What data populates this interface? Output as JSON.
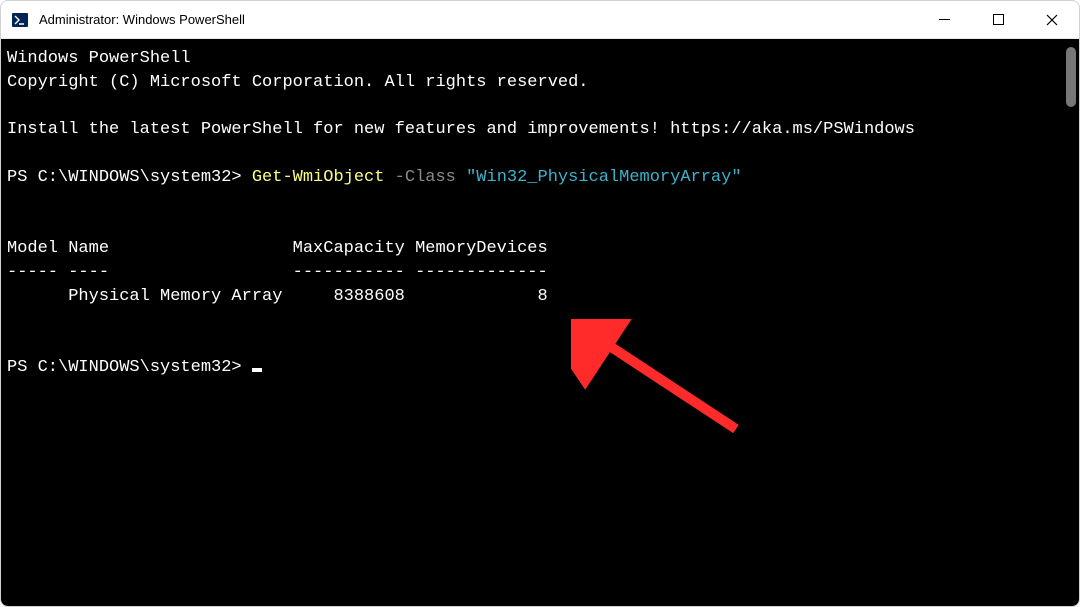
{
  "titlebar": {
    "title": "Administrator: Windows PowerShell"
  },
  "terminal": {
    "header1": "Windows PowerShell",
    "header2": "Copyright (C) Microsoft Corporation. All rights reserved.",
    "install_msg": "Install the latest PowerShell for new features and improvements! https://aka.ms/PSWindows",
    "prompt1": "PS C:\\WINDOWS\\system32> ",
    "cmd": "Get-WmiObject",
    "flag": " -Class ",
    "arg": "\"Win32_PhysicalMemoryArray\"",
    "columns_line": "Model Name                  MaxCapacity MemoryDevices",
    "divider_line": "----- ----                  ----------- -------------",
    "data_line": "      Physical Memory Array     8388608             8",
    "prompt2": "PS C:\\WINDOWS\\system32> "
  }
}
